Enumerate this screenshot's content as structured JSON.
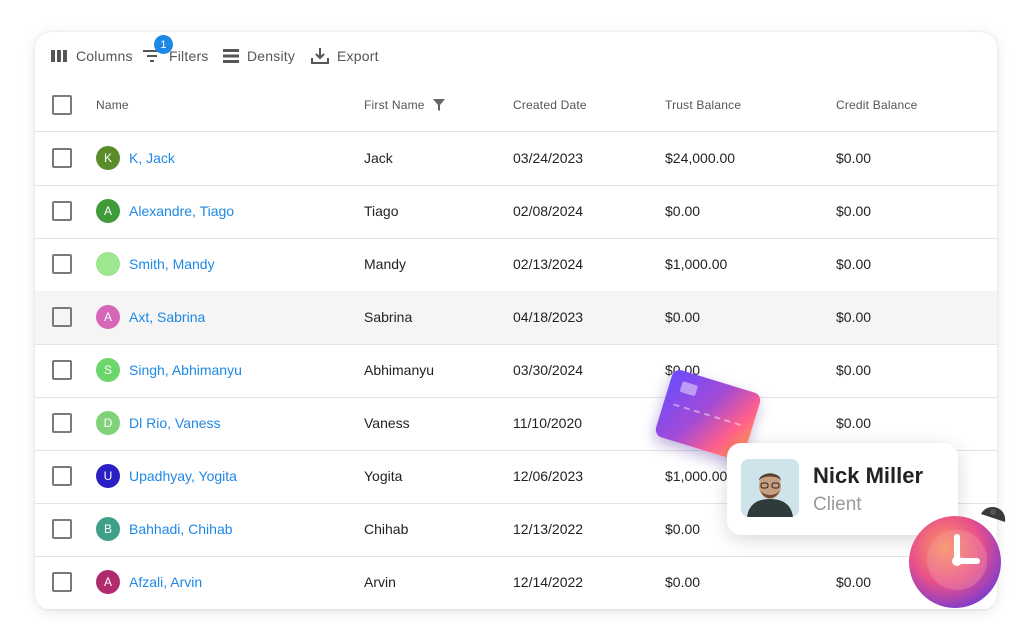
{
  "toolbar": {
    "columns_label": "Columns",
    "filters_label": "Filters",
    "filters_badge": "1",
    "density_label": "Density",
    "export_label": "Export"
  },
  "headers": {
    "name": "Name",
    "first_name": "First Name",
    "created_date": "Created Date",
    "trust_balance": "Trust Balance",
    "credit_balance": "Credit Balance"
  },
  "rows": [
    {
      "initial": "K",
      "avatar_color": "#5b8c2a",
      "name": "K, Jack",
      "first_name": "Jack",
      "created": "03/24/2023",
      "trust": "$24,000.00",
      "credit": "$0.00"
    },
    {
      "initial": "A",
      "avatar_color": "#3f9a3a",
      "name": "Alexandre, Tiago",
      "first_name": "Tiago",
      "created": "02/08/2024",
      "trust": "$0.00",
      "credit": "$0.00"
    },
    {
      "initial": "",
      "avatar_color": "#9ee68f",
      "name": "Smith, Mandy",
      "first_name": "Mandy",
      "created": "02/13/2024",
      "trust": "$1,000.00",
      "credit": "$0.00"
    },
    {
      "initial": "A",
      "avatar_color": "#d667b8",
      "name": "Axt, Sabrina",
      "first_name": "Sabrina",
      "created": "04/18/2023",
      "trust": "$0.00",
      "credit": "$0.00"
    },
    {
      "initial": "S",
      "avatar_color": "#6cd66a",
      "name": "Singh, Abhimanyu",
      "first_name": "Abhimanyu",
      "created": "03/30/2024",
      "trust": "$0.00",
      "credit": "$0.00"
    },
    {
      "initial": "D",
      "avatar_color": "#7fd27a",
      "name": "Dl Rio, Vaness",
      "first_name": "Vaness",
      "created": "11/10/2020",
      "trust": "",
      "credit": "$0.00"
    },
    {
      "initial": "U",
      "avatar_color": "#2a1fc4",
      "name": "Upadhyay, Yogita",
      "first_name": "Yogita",
      "created": "12/06/2023",
      "trust": "$1,000.00",
      "credit": ""
    },
    {
      "initial": "B",
      "avatar_color": "#3fa08a",
      "name": "Bahhadi, Chihab",
      "first_name": "Chihab",
      "created": "12/13/2022",
      "trust": "$0.00",
      "credit": ""
    },
    {
      "initial": "A",
      "avatar_color": "#b02a6e",
      "name": "Afzali, Arvin",
      "first_name": "Arvin",
      "created": "12/14/2022",
      "trust": "$0.00",
      "credit": "$0.00"
    }
  ],
  "highlighted_row": 3,
  "client_card": {
    "name": "Nick Miller",
    "role": "Client"
  },
  "icons": {
    "columns": "columns-icon",
    "filters": "filter-icon",
    "density": "density-icon",
    "export": "download-icon",
    "column_filter": "funnel-icon"
  },
  "colors": {
    "link": "#1e88e5",
    "badge": "#1e88e5",
    "row_highlight": "#f5f5f5"
  }
}
